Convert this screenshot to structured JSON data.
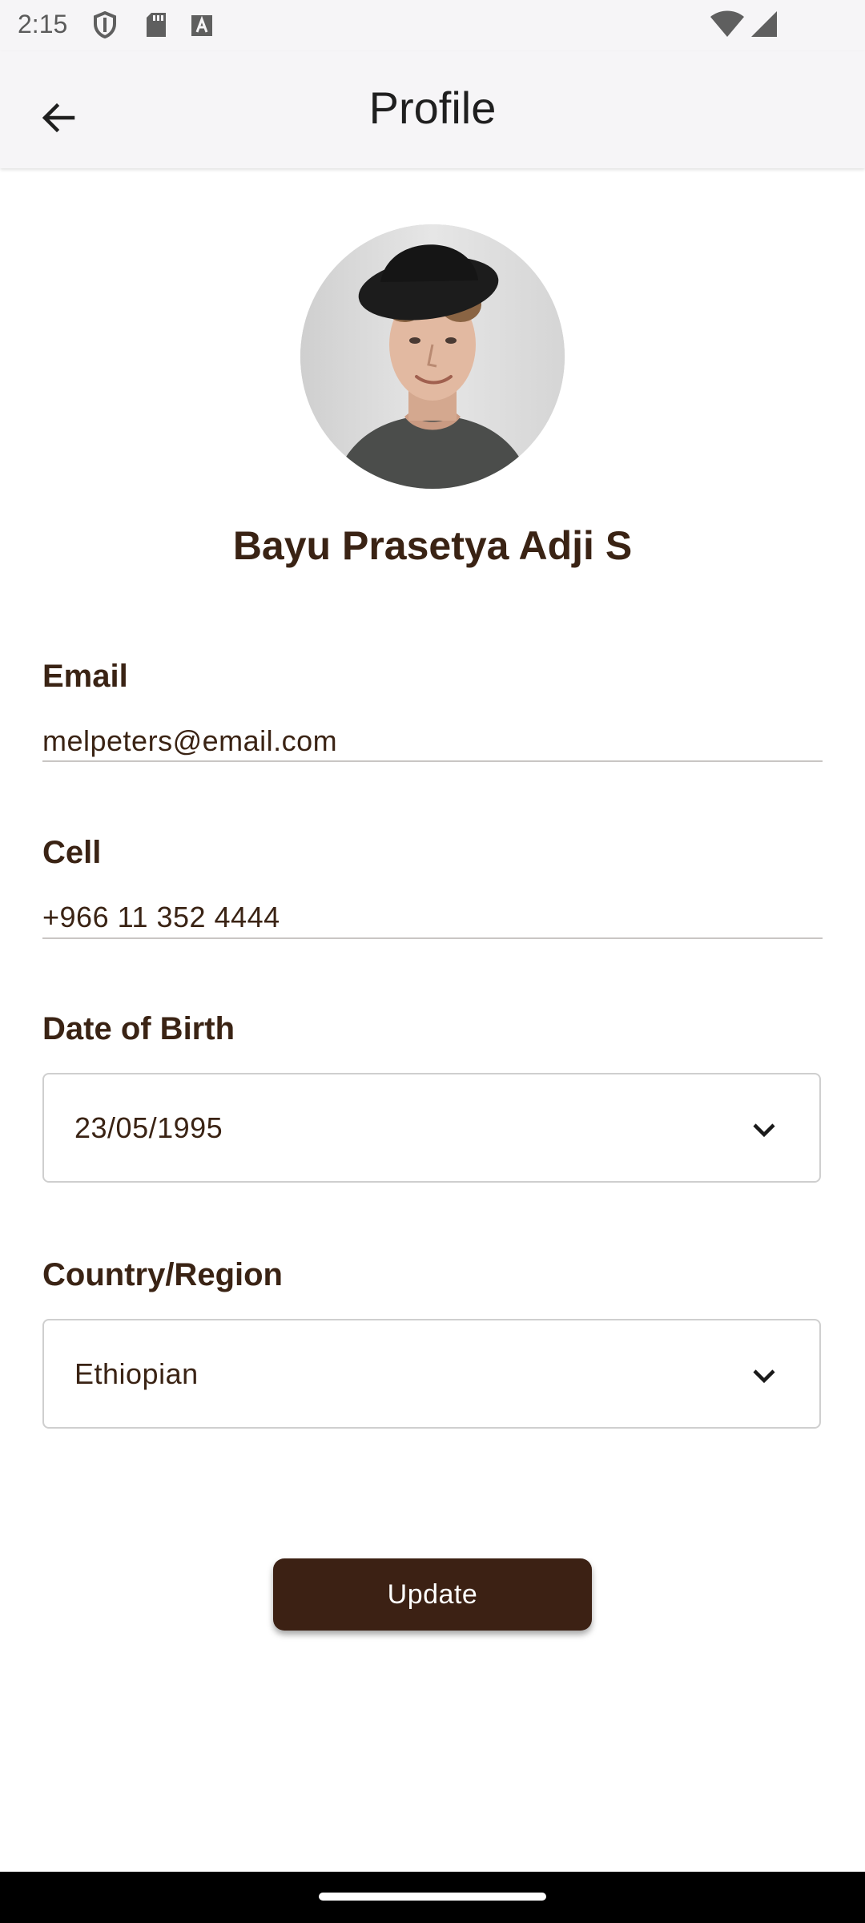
{
  "status_bar": {
    "time": "2:15",
    "icons": [
      "shield-icon",
      "sd-card-icon",
      "font-a-icon",
      "wifi-icon",
      "signal-icon"
    ]
  },
  "app_bar": {
    "title": "Profile",
    "back_icon": "arrow-left-icon"
  },
  "profile": {
    "name": "Bayu Prasetya Adji S",
    "avatar": "avatar-photo"
  },
  "fields": {
    "email": {
      "label": "Email",
      "value": "melpeters@email.com"
    },
    "cell": {
      "label": "Cell",
      "value": "+966 11 352 4444"
    },
    "dob": {
      "label": "Date of Birth",
      "value": "23/05/1995"
    },
    "country": {
      "label": "Country/Region",
      "value": "Ethiopian"
    }
  },
  "actions": {
    "update_label": "Update"
  },
  "colors": {
    "primary": "#3c2114",
    "text": "#3a2314",
    "appbar_bg": "#f6f5f7",
    "divider": "#c9c6c4"
  }
}
